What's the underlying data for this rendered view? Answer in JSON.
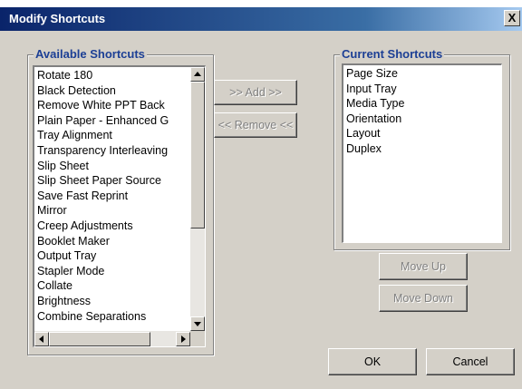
{
  "window": {
    "title": "Modify Shortcuts",
    "close_symbol": "X"
  },
  "available": {
    "label": "Available Shortcuts",
    "items": [
      "Rotate 180",
      "Black Detection",
      "Remove White PPT Back",
      "Plain Paper - Enhanced G",
      "Tray Alignment",
      "Transparency Interleaving",
      "Slip Sheet",
      "Slip Sheet Paper Source",
      "Save Fast Reprint",
      "Mirror",
      "Creep Adjustments",
      "Booklet Maker",
      "Output Tray",
      "Stapler Mode",
      "Collate",
      "Brightness",
      "Combine Separations"
    ]
  },
  "current": {
    "label": "Current Shortcuts",
    "items": [
      "Page Size",
      "Input Tray",
      "Media Type",
      "Orientation",
      "Layout",
      "Duplex"
    ]
  },
  "buttons": {
    "add": ">> Add >>",
    "remove": "<< Remove <<",
    "move_up": "Move Up",
    "move_down": "Move Down",
    "ok": "OK",
    "cancel": "Cancel"
  },
  "colors": {
    "titlebar": "#0a246a",
    "group_label": "#1c3f95",
    "face": "#d4d0c8"
  }
}
